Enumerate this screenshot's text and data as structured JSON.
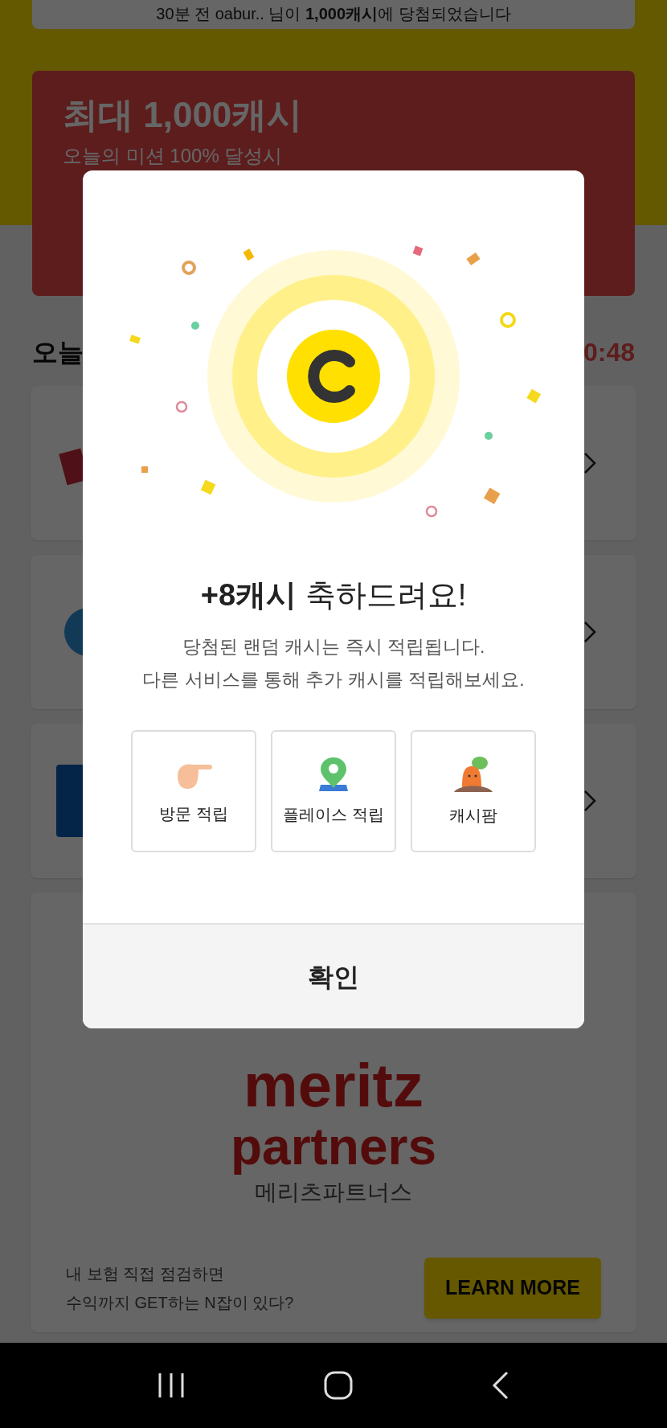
{
  "ticker": {
    "text": "30분 전 oabur.. 님이 **1,000캐시**에 당첨되었습니다"
  },
  "banner": {
    "title": "최대 1,000캐시",
    "subtitle": "오늘의 미션 100% 달성시"
  },
  "section": {
    "title": "오늘",
    "timer": "0:48"
  },
  "cards": [
    {
      "kind": "red-logo"
    },
    {
      "kind": "blue-logo"
    },
    {
      "kind": "navy-logo"
    }
  ],
  "ad": {
    "brand": "meritz",
    "brand_line2": "partners",
    "brand_korean": "메리츠파트너스",
    "text_lines": [
      "내 보험 직접 점검하면",
      "수익까지 GET하는 N잡이 있다?"
    ],
    "button": "LEARN MORE"
  },
  "dialog": {
    "title": "**+8캐시** 축하드려요!",
    "message_lines": [
      "당첨된 랜덤 캐시는 즉시 적립됩니다.",
      "다른 서비스를 통해 추가 캐시를 적립해보세요."
    ],
    "services": [
      {
        "label": "방문 적립",
        "kind": "pointing-hand"
      },
      {
        "label": "플레이스 적립",
        "kind": "map-pin"
      },
      {
        "label": "캐시팜",
        "kind": "carrot"
      }
    ],
    "confirm": "확인"
  }
}
